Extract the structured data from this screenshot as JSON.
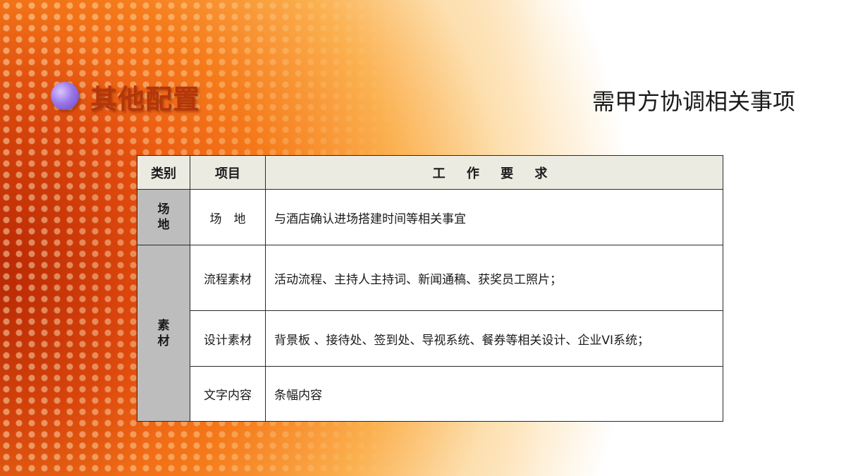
{
  "slide": {
    "title": "其他配置",
    "subtitle": "需甲方协调相关事项"
  },
  "table": {
    "headers": {
      "category": "类别",
      "item": "项目",
      "requirement": "工 作 要 求"
    },
    "rows": [
      {
        "category": "场地",
        "item": "场　地",
        "requirement": "与酒店确认进场搭建时间等相关事宜"
      },
      {
        "category": "素材",
        "item": "流程素材",
        "requirement": "活动流程、主持人主持词、新闻通稿、获奖员工照片；"
      },
      {
        "item": "设计素材",
        "requirement": "背景板 、接待处、签到处、导视系统、餐券等相关设计、企业VI系统；"
      },
      {
        "item": "文字内容",
        "requirement": "条幅内容"
      }
    ]
  },
  "colors": {
    "title": "#b5360a",
    "bullet": "#9a78e6",
    "header_bg": "#ecebe2",
    "category_bg": "#bdbdbd",
    "background_accent": "#f06e18"
  }
}
